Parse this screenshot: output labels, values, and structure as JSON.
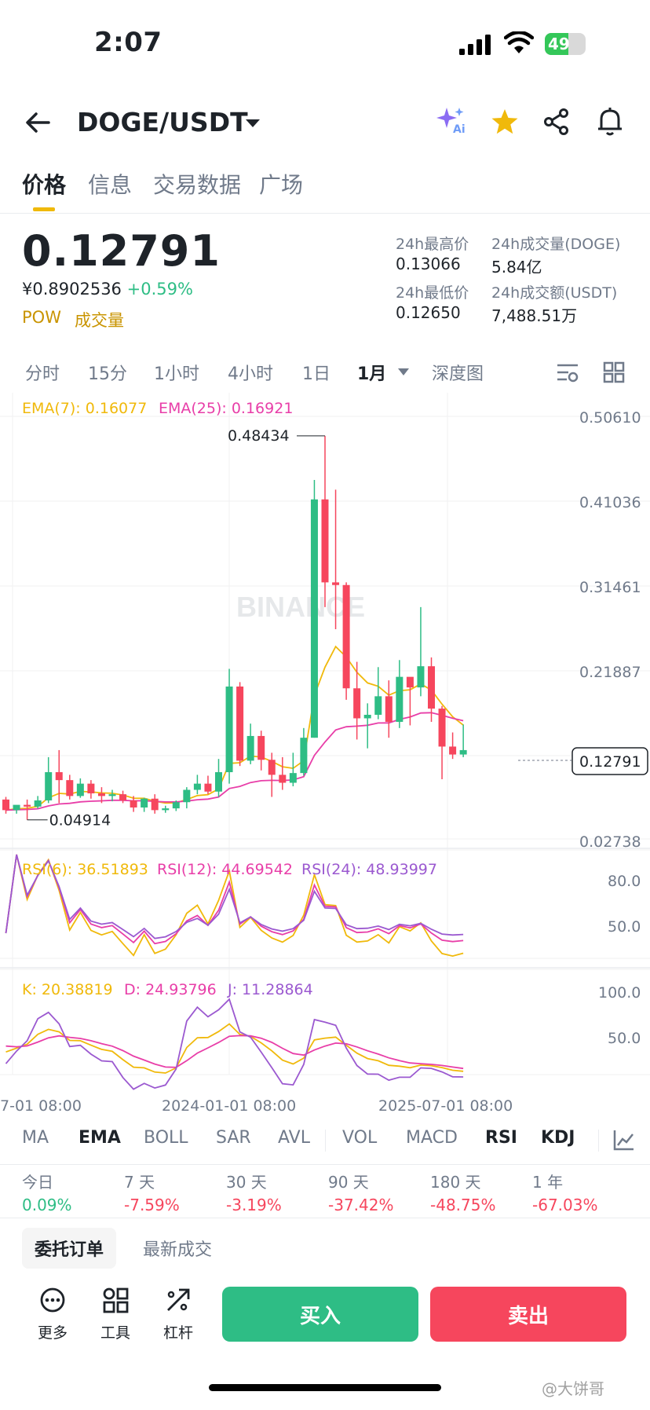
{
  "status": {
    "time": "2:07",
    "battery": "49"
  },
  "header": {
    "pair": "DOGE/USDT",
    "ai_badge": "Ai"
  },
  "tabs": [
    "价格",
    "信息",
    "交易数据",
    "广场"
  ],
  "price": {
    "last": "0.12791",
    "cny": "¥0.8902536",
    "change": "+0.59%",
    "tag1": "POW",
    "tag2": "成交量"
  },
  "stats": {
    "high_label": "24h最高价",
    "high_value": "0.13066",
    "vol_label": "24h成交量(DOGE)",
    "vol_value": "5.84亿",
    "low_label": "24h最低价",
    "low_value": "0.12650",
    "amount_label": "24h成交额(USDT)",
    "amount_value": "7,488.51万"
  },
  "intervals": [
    "分时",
    "15分",
    "1小时",
    "4小时",
    "1日",
    "1月",
    "深度图"
  ],
  "chart": {
    "ema_label_7": "EMA(7): 0.16077",
    "ema_label_25": "EMA(25): 0.16921",
    "price_axis": [
      "0.50610",
      "0.41036",
      "0.31461",
      "0.21887",
      "0.12791",
      "0.02738"
    ],
    "high_marker": "0.48434",
    "low_marker": "0.04914",
    "watermark": "BINANCE",
    "rsi_label_6": "RSI(6): 36.51893",
    "rsi_label_12": "RSI(12): 44.69542",
    "rsi_label_24": "RSI(24): 48.93997",
    "rsi_axis": [
      "80.0",
      "50.0"
    ],
    "kdj_label_k": "K: 20.38819",
    "kdj_label_d": "D: 24.93796",
    "kdj_label_j": "J: 11.28864",
    "kdj_axis": [
      "100.0",
      "50.0"
    ],
    "time_axis": [
      "7-01 08:00",
      "2024-01-01 08:00",
      "2025-07-01 08:00"
    ],
    "colors": {
      "up": "#2ebd85",
      "down": "#f6465d",
      "ema7": "#f0b90b",
      "ema25": "#e83ea8",
      "rsi24": "#9b59d0"
    }
  },
  "chart_data": {
    "type": "candlestick",
    "interval": "1M",
    "ylim": [
      0.02738,
      0.5061
    ],
    "candles": [
      {
        "o": 0.072,
        "h": 0.075,
        "c": 0.06,
        "l": 0.056
      },
      {
        "o": 0.06,
        "h": 0.065,
        "c": 0.066,
        "l": 0.056
      },
      {
        "o": 0.066,
        "h": 0.072,
        "c": 0.064,
        "l": 0.049
      },
      {
        "o": 0.064,
        "h": 0.076,
        "c": 0.071,
        "l": 0.062
      },
      {
        "o": 0.071,
        "h": 0.12,
        "c": 0.103,
        "l": 0.068
      },
      {
        "o": 0.103,
        "h": 0.128,
        "c": 0.094,
        "l": 0.068
      },
      {
        "o": 0.094,
        "h": 0.1,
        "c": 0.076,
        "l": 0.072
      },
      {
        "o": 0.076,
        "h": 0.096,
        "c": 0.09,
        "l": 0.074
      },
      {
        "o": 0.09,
        "h": 0.094,
        "c": 0.079,
        "l": 0.073
      },
      {
        "o": 0.079,
        "h": 0.086,
        "c": 0.076,
        "l": 0.068
      },
      {
        "o": 0.076,
        "h": 0.083,
        "c": 0.078,
        "l": 0.07
      },
      {
        "o": 0.078,
        "h": 0.082,
        "c": 0.071,
        "l": 0.068
      },
      {
        "o": 0.071,
        "h": 0.076,
        "c": 0.063,
        "l": 0.058
      },
      {
        "o": 0.063,
        "h": 0.074,
        "c": 0.073,
        "l": 0.058
      },
      {
        "o": 0.073,
        "h": 0.078,
        "c": 0.06,
        "l": 0.056
      },
      {
        "o": 0.06,
        "h": 0.065,
        "c": 0.062,
        "l": 0.057
      },
      {
        "o": 0.062,
        "h": 0.071,
        "c": 0.069,
        "l": 0.059
      },
      {
        "o": 0.069,
        "h": 0.086,
        "c": 0.083,
        "l": 0.062
      },
      {
        "o": 0.083,
        "h": 0.1,
        "c": 0.09,
        "l": 0.078
      },
      {
        "o": 0.09,
        "h": 0.099,
        "c": 0.081,
        "l": 0.078
      },
      {
        "o": 0.081,
        "h": 0.118,
        "c": 0.103,
        "l": 0.075
      },
      {
        "o": 0.103,
        "h": 0.22,
        "c": 0.2,
        "l": 0.09
      },
      {
        "o": 0.2,
        "h": 0.205,
        "c": 0.116,
        "l": 0.11
      },
      {
        "o": 0.116,
        "h": 0.158,
        "c": 0.144,
        "l": 0.112
      },
      {
        "o": 0.144,
        "h": 0.15,
        "c": 0.117,
        "l": 0.105
      },
      {
        "o": 0.117,
        "h": 0.125,
        "c": 0.1,
        "l": 0.075
      },
      {
        "o": 0.1,
        "h": 0.12,
        "c": 0.091,
        "l": 0.083
      },
      {
        "o": 0.091,
        "h": 0.125,
        "c": 0.102,
        "l": 0.087
      },
      {
        "o": 0.102,
        "h": 0.153,
        "c": 0.142,
        "l": 0.099
      },
      {
        "o": 0.142,
        "h": 0.434,
        "c": 0.412,
        "l": 0.142
      },
      {
        "o": 0.412,
        "h": 0.484,
        "c": 0.318,
        "l": 0.29
      },
      {
        "o": 0.318,
        "h": 0.423,
        "c": 0.315,
        "l": 0.265
      },
      {
        "o": 0.315,
        "h": 0.318,
        "c": 0.198,
        "l": 0.185
      },
      {
        "o": 0.198,
        "h": 0.228,
        "c": 0.164,
        "l": 0.14
      },
      {
        "o": 0.164,
        "h": 0.181,
        "c": 0.168,
        "l": 0.13
      },
      {
        "o": 0.168,
        "h": 0.222,
        "c": 0.189,
        "l": 0.163
      },
      {
        "o": 0.189,
        "h": 0.207,
        "c": 0.16,
        "l": 0.142
      },
      {
        "o": 0.16,
        "h": 0.23,
        "c": 0.211,
        "l": 0.153
      },
      {
        "o": 0.211,
        "h": 0.2,
        "c": 0.199,
        "l": 0.156
      },
      {
        "o": 0.199,
        "h": 0.29,
        "c": 0.223,
        "l": 0.189
      },
      {
        "o": 0.223,
        "h": 0.233,
        "c": 0.175,
        "l": 0.16
      },
      {
        "o": 0.175,
        "h": 0.178,
        "c": 0.132,
        "l": 0.095
      },
      {
        "o": 0.132,
        "h": 0.148,
        "c": 0.123,
        "l": 0.118
      },
      {
        "o": 0.123,
        "h": 0.157,
        "c": 0.128,
        "l": 0.12
      }
    ]
  },
  "indicators": [
    "MA",
    "EMA",
    "BOLL",
    "SAR",
    "AVL",
    "VOL",
    "MACD",
    "RSI",
    "KDJ"
  ],
  "performance": [
    {
      "label": "今日",
      "value": "0.09%",
      "dir": "up"
    },
    {
      "label": "7 天",
      "value": "-7.59%",
      "dir": "down"
    },
    {
      "label": "30 天",
      "value": "-3.19%",
      "dir": "down"
    },
    {
      "label": "90 天",
      "value": "-37.42%",
      "dir": "down"
    },
    {
      "label": "180 天",
      "value": "-48.75%",
      "dir": "down"
    },
    {
      "label": "1 年",
      "value": "-67.03%",
      "dir": "down"
    }
  ],
  "orders": {
    "tab1": "委托订单",
    "tab2": "最新成交"
  },
  "bottom": {
    "more": "更多",
    "tools": "工具",
    "leverage": "杠杆",
    "buy": "买入",
    "sell": "卖出"
  },
  "credit": "@大饼哥"
}
